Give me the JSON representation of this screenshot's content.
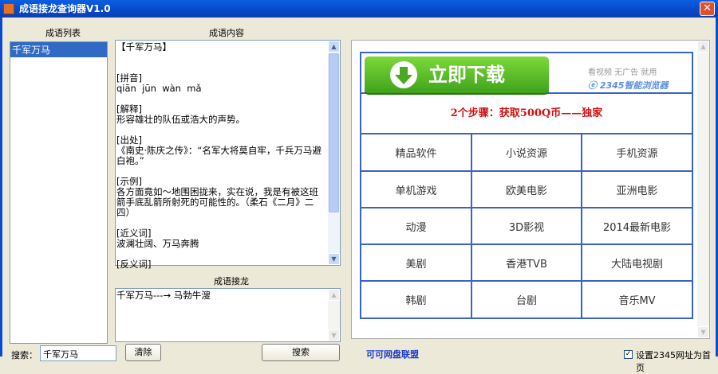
{
  "window": {
    "title": "成语接龙查询器V1.0",
    "close_icon": "close-icon"
  },
  "list": {
    "label": "成语列表",
    "items": [
      "千军万马"
    ]
  },
  "content": {
    "label": "成语内容",
    "lines": [
      "【千军万马】",
      "",
      "",
      "[拼音]",
      "qiān  jūn  wàn  mǎ",
      "",
      "[解释]",
      "形容雄壮的队伍或浩大的声势。",
      "",
      "[出处]",
      "《南史·陈庆之传》：“名军大将莫自牢，千兵万马避白袍。”",
      "",
      "[示例]",
      "各方面竟如～地围困拢来，实在说，我是有被这班箭手底乱箭所射死的可能性的。（柔石《二月》二四）",
      "",
      "[近义词]",
      "波澜壮阔、万马奔腾",
      "",
      "[反义词]"
    ]
  },
  "chain": {
    "label": "成语接龙",
    "text": "千军万马---→ 马勃牛溲"
  },
  "ad": {
    "download_label": "立即下载",
    "tagline": "看视频 无广告 就用",
    "logo_text": "2345智能浏览器",
    "promo": "2个步骤：获取500Q币——独家",
    "cells": [
      [
        "精品软件",
        "小说资源",
        "手机资源"
      ],
      [
        "单机游戏",
        "欧美电影",
        "亚洲电影"
      ],
      [
        "动漫",
        "3D影视",
        "2014最新电影"
      ],
      [
        "美剧",
        "香港TVB",
        "大陆电视剧"
      ],
      [
        "韩剧",
        "台剧",
        "音乐MV"
      ]
    ]
  },
  "footer": {
    "search_label": "搜索：",
    "search_value": "千军万马",
    "clear_label": "清除",
    "search_button": "搜索",
    "link": "可可网盘联盟",
    "homepage_checkbox": "设置2345网址为首页",
    "homepage_checked": true
  }
}
